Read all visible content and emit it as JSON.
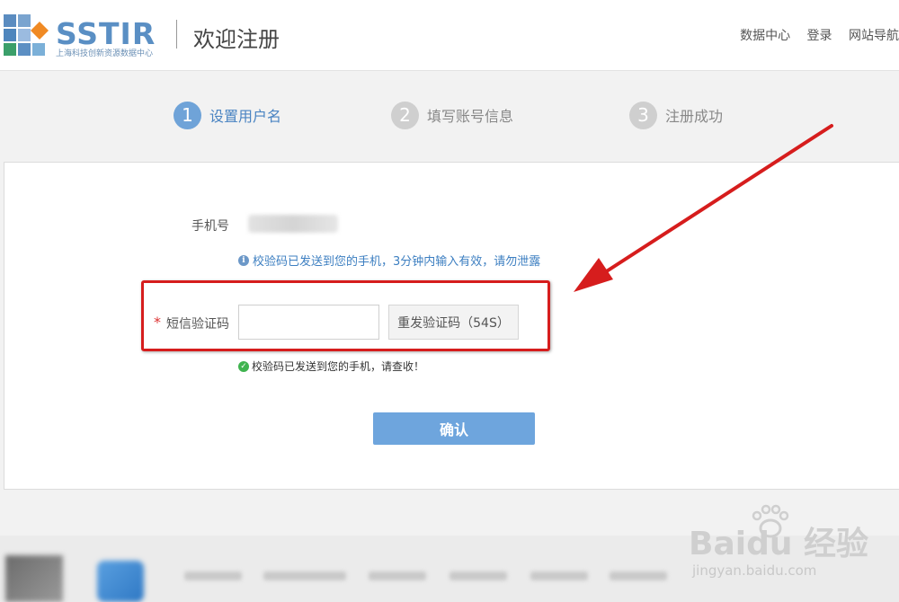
{
  "header": {
    "logo_text": "SSTIR",
    "logo_subtitle": "上海科技创新资源数据中心",
    "title": "欢迎注册",
    "links": [
      "数据中心",
      "登录",
      "网站导航"
    ]
  },
  "steps": [
    {
      "number": "1",
      "label": "设置用户名",
      "state": "active"
    },
    {
      "number": "2",
      "label": "填写账号信息",
      "state": "inactive"
    },
    {
      "number": "3",
      "label": "注册成功",
      "state": "inactive"
    }
  ],
  "form": {
    "phone_label": "手机号",
    "info_message": "校验码已发送到您的手机，3分钟内输入有效，请勿泄露",
    "required_mark": "*",
    "sms_label": "短信验证码",
    "sms_value": "",
    "resend_label": "重发验证码（54S）",
    "success_message": "校验码已发送到您的手机，请查收！",
    "confirm_label": "确认"
  },
  "watermark": {
    "brand": "Baidu 经验",
    "url": "jingyan.baidu.com"
  },
  "colors": {
    "accent": "#6fa3d8",
    "annotation_red": "#d61d1d",
    "success_green": "#3fb34f"
  }
}
